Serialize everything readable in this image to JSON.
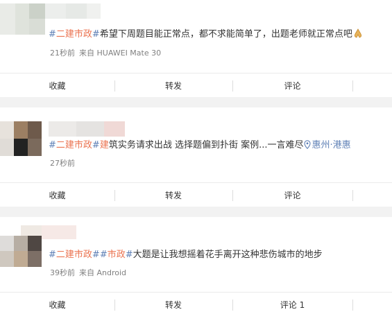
{
  "posts": [
    {
      "tag": "#二建市政#",
      "text": "希望下周题目能正常点，都不求能简单了，出题老师就正常点吧",
      "emoji_icon": "praying-hands-icon",
      "time": "21秒前",
      "source": "来自 HUAWEI Mate 30",
      "actions": [
        "收藏",
        "转发",
        "评论"
      ]
    },
    {
      "tag": "#二建市政#",
      "tag_tail": "建",
      "text": "筑实务请求出战 选择题偏到扑街 案例...一言难尽",
      "location": "惠州·港惠",
      "location_icon": "map-pin-icon",
      "time": "27秒前",
      "actions": [
        "收藏",
        "转发",
        "评论"
      ]
    },
    {
      "tag": "#二建市政#",
      "tag2": "#市政#",
      "text": "大题是让我想摇着花手离开这种悲伤城市的地步",
      "time": "39秒前",
      "source": "来自 Android",
      "actions": [
        "收藏",
        "转发",
        "评论 1"
      ]
    }
  ],
  "colors": {
    "tag_red": "#eb7350",
    "hash_blue": "#5d7fb5",
    "meta_gray": "#808080",
    "background": "#f2f2f2"
  }
}
